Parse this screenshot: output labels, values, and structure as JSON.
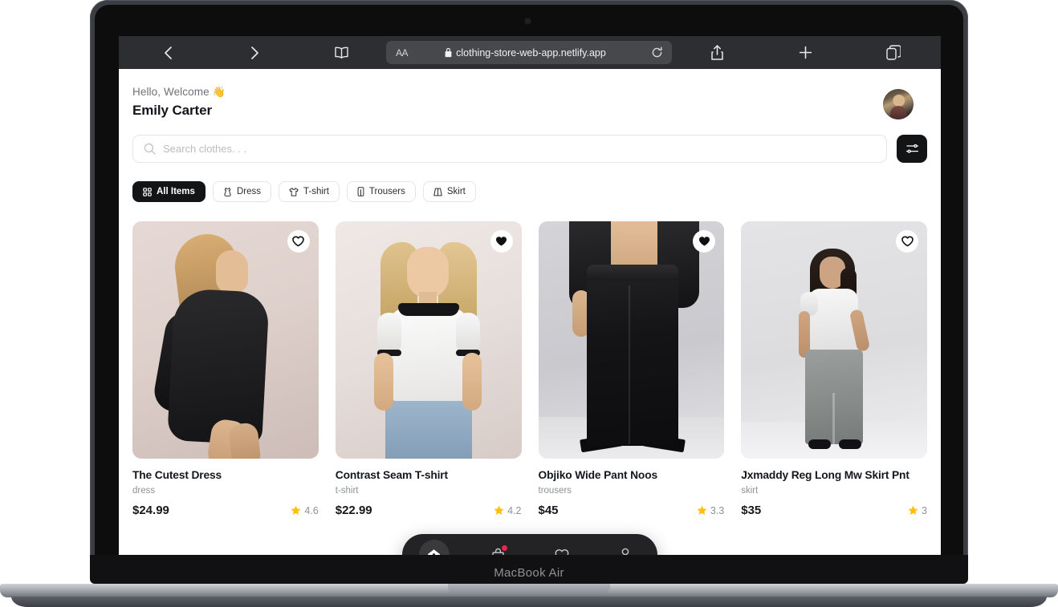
{
  "device": {
    "model_label": "MacBook Air"
  },
  "browser": {
    "back_icon": "chevron-left-icon",
    "forward_icon": "chevron-right-icon",
    "reader_icon": "book-icon",
    "text_size_label": "AA",
    "lock_icon": "lock-icon",
    "url": "clothing-store-web-app.netlify.app",
    "reload_icon": "reload-icon",
    "share_icon": "share-icon",
    "new_tab_icon": "plus-icon",
    "tabs_icon": "tabs-icon"
  },
  "header": {
    "greeting": "Hello, Welcome ",
    "greeting_emoji": "👋",
    "user_name": "Emily Carter",
    "avatar_name": "user-avatar"
  },
  "search": {
    "placeholder": "Search clothes. . .",
    "value": "",
    "search_icon": "search-icon",
    "filter_icon": "sliders-icon"
  },
  "categories": [
    {
      "label": "All Items",
      "icon": "grid-icon",
      "active": true
    },
    {
      "label": "Dress",
      "icon": "dress-icon",
      "active": false
    },
    {
      "label": "T-shirt",
      "icon": "tshirt-icon",
      "active": false
    },
    {
      "label": "Trousers",
      "icon": "trousers-icon",
      "active": false
    },
    {
      "label": "Skirt",
      "icon": "skirt-icon",
      "active": false
    }
  ],
  "products": [
    {
      "title": "The Cutest Dress",
      "category": "dress",
      "price": "$24.99",
      "rating": "4.6",
      "favorited": false
    },
    {
      "title": "Contrast Seam T-shirt",
      "category": "t-shirt",
      "price": "$22.99",
      "rating": "4.2",
      "favorited": true
    },
    {
      "title": "Objiko Wide Pant Noos",
      "category": "trousers",
      "price": "$45",
      "rating": "3.3",
      "favorited": true
    },
    {
      "title": "Jxmaddy Reg Long Mw Skirt Pnt",
      "category": "skirt",
      "price": "$35",
      "rating": "3",
      "favorited": false
    }
  ],
  "bottom_nav": [
    {
      "icon": "home-icon",
      "active": true,
      "badge": false
    },
    {
      "icon": "bag-icon",
      "active": false,
      "badge": true
    },
    {
      "icon": "heart-icon",
      "active": false,
      "badge": false
    },
    {
      "icon": "person-icon",
      "active": false,
      "badge": false
    }
  ],
  "colors": {
    "accent_dark": "#131416",
    "star": "#ffc107",
    "badge": "#f4224a",
    "muted_text": "#8e9197"
  }
}
